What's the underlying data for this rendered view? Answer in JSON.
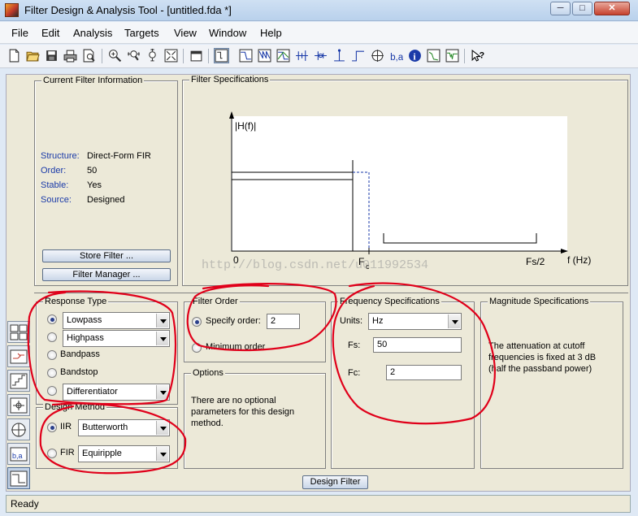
{
  "window": {
    "title": "Filter Design & Analysis Tool -  [untitled.fda *]",
    "min_label": "─",
    "max_label": "□",
    "close_label": "✕"
  },
  "menu": [
    "File",
    "Edit",
    "Analysis",
    "Targets",
    "View",
    "Window",
    "Help"
  ],
  "toolbar_icons": [
    "new-icon",
    "open-icon",
    "save-icon",
    "print-icon",
    "print-preview-icon",
    "zoom-in-icon",
    "zoom-x-icon",
    "zoom-y-icon",
    "full-view-icon",
    "new-window-icon",
    "filter-specs-icon",
    "magnitude-response-icon",
    "phase-response-icon",
    "magnitude-phase-icon",
    "group-delay-icon",
    "phase-delay-icon",
    "impulse-response-icon",
    "step-response-icon",
    "pole-zero-icon",
    "coefficients-icon",
    "info-icon",
    "magnitude-estimate-icon",
    "noise-power-icon",
    "whats-this-icon"
  ],
  "current_filter": {
    "title": "Current Filter Information",
    "rows": [
      {
        "label": "Structure:",
        "value": "Direct-Form FIR"
      },
      {
        "label": "Order:",
        "value": "50"
      },
      {
        "label": "Stable:",
        "value": "Yes"
      },
      {
        "label": "Source:",
        "value": "Designed"
      }
    ],
    "store_button": "Store Filter ...",
    "manager_button": "Filter Manager ..."
  },
  "filter_specs": {
    "title": "Filter Specifications",
    "ylabel": "|H(f)|",
    "x0": "0",
    "fc": "F",
    "fc_sub": "c",
    "fs2": "Fs/2",
    "xlabel": "f (Hz)"
  },
  "response_type": {
    "title": "Response Type",
    "lowpass": "Lowpass",
    "highpass": "Highpass",
    "bandpass": "Bandpass",
    "bandstop": "Bandstop",
    "differentiator": "Differentiator"
  },
  "design_method": {
    "title": "Design Method",
    "iir_label": "IIR",
    "iir_value": "Butterworth",
    "fir_label": "FIR",
    "fir_value": "Equiripple"
  },
  "filter_order": {
    "title": "Filter Order",
    "specify_label": "Specify order:",
    "specify_value": "2",
    "minimum_label": "Minimum order"
  },
  "options": {
    "title": "Options",
    "text": "There are no optional parameters for this design method."
  },
  "frequency_specs": {
    "title": "Frequency Specifications",
    "units_label": "Units:",
    "units_value": "Hz",
    "fs_label": "Fs:",
    "fs_value": "50",
    "fc_label": "Fc:",
    "fc_value": "2"
  },
  "magnitude_specs": {
    "title": "Magnitude Specifications",
    "text": "The attenuation at cutoff frequencies is fixed at 3 dB (half the passband power)"
  },
  "design_button": "Design Filter",
  "status": "Ready",
  "watermark": "http://blog.csdn.net/u011992534",
  "annotation_color": "#e0001a"
}
